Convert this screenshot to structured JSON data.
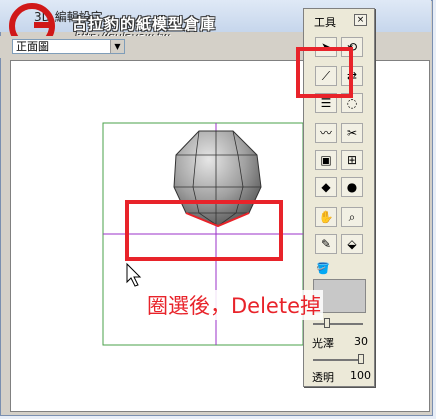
{
  "window": {
    "title": "3D 編輯設定",
    "watermark": "古拉豹的紙模型倉庫",
    "watermark_url": "http://gulavaw.tw",
    "view_select": "正面圖"
  },
  "toolbox": {
    "title": "工具",
    "close": "×",
    "gloss_label": "光澤",
    "gloss_value": "30",
    "opacity_label": "透明",
    "opacity_value": "100"
  },
  "annotation": {
    "text": "圈選後，Delete掉",
    "color": "#e8232a"
  },
  "colors": {
    "guide_green": "#4aa04a",
    "guide_purple": "#9b30c8",
    "selection_red": "#e8232a",
    "swatch": "#c8c8c8"
  },
  "tools": [
    [
      "select-arrow-icon",
      "rotate-icon"
    ],
    [
      "line-edit-icon",
      "reverse-icon"
    ],
    [
      "align-icon",
      "lasso-icon"
    ],
    [
      "curve-icon",
      "cut-edge-icon"
    ],
    [
      "box-3d-icon",
      "move-face-icon"
    ],
    [
      "flat-shape-icon",
      "sphere-icon"
    ],
    [
      "hand-pan-icon",
      "zoom-icon"
    ],
    [
      "eyedropper-icon",
      "paint-bucket-icon"
    ]
  ]
}
